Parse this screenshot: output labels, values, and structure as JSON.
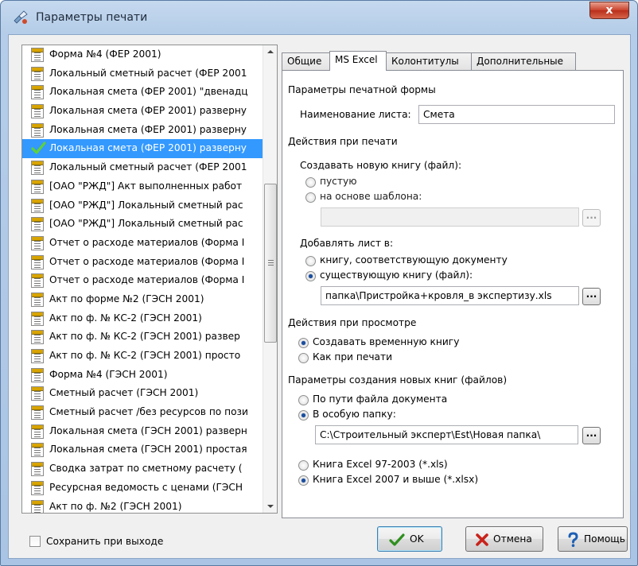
{
  "window": {
    "title": "Параметры печати",
    "close_label": "x"
  },
  "forms_list": {
    "selected_index": 5,
    "items": [
      "Форма №4 (ФЕР 2001)",
      "Локальный сметный расчет (ФЕР 2001",
      "Локальная смета (ФЕР 2001) \"двенадц",
      "Локальная смета (ФЕР 2001) разверну",
      "Локальная смета (ФЕР 2001) разверну",
      "Локальная смета (ФЕР 2001) разверну",
      "Локальный сметный расчет (ФЕР 2001",
      "[ОАО \"РЖД\"] Акт выполненных работ",
      "[ОАО \"РЖД\"] Локальный сметный рас",
      "[ОАО \"РЖД\"] Локальный сметный рас",
      "Отчет о расходе материалов (Форма I",
      "Отчет о расходе материалов (Форма I",
      "Отчет о расходе материалов (Форма I",
      "Акт по форме №2 (ГЭСН 2001)",
      "Акт по ф. № КС-2 (ГЭСН 2001)",
      "Акт по ф. № КС-2 (ГЭСН 2001) развер",
      "Акт по ф. № КС-2 (ГЭСН 2001) просто",
      "Форма №4 (ГЭСН 2001)",
      "Сметный расчет (ГЭСН 2001)",
      "Сметный расчет /без ресурсов по пози",
      "Локальная смета (ГЭСН 2001) разверн",
      "Локальная смета (ГЭСН 2001) простая",
      "Сводка затрат по сметному расчету (",
      "Ресурсная ведомость с ценами (ГЭСН",
      "Акт по ф. №2 (ГЭСН 2001)"
    ]
  },
  "tabs": [
    {
      "label": "Общие",
      "active": false
    },
    {
      "label": "MS Excel",
      "active": true
    },
    {
      "label": "Колонтитулы",
      "active": false
    },
    {
      "label": "Дополнительные",
      "active": false
    }
  ],
  "excel": {
    "print_form_group": "Параметры печатной формы",
    "sheet_name_label": "Наименование листа:",
    "sheet_name_value": "Смета",
    "print_actions_group": "Действия при печати",
    "create_book_label": "Создавать новую книгу (файл):",
    "opt_empty": "пустую",
    "opt_template": "на основе шаблона:",
    "template_path": "",
    "add_sheet_label": "Добавлять лист в:",
    "opt_doc_book": "книгу, соответствующую документу",
    "opt_existing_book": "существующую книгу (файл):",
    "existing_book_path": "папка\\Пристройка+кровля_в экспертизу.xls",
    "view_actions_group": "Действия при просмотре",
    "opt_temp_book": "Создавать временную книгу",
    "opt_as_print": "Как при печати",
    "new_books_group": "Параметры создания новых книг (файлов)",
    "opt_doc_path": "По пути файла документа",
    "opt_special_folder": "В особую папку:",
    "special_folder_path": "C:\\Строительный эксперт\\Est\\Новая папка\\",
    "opt_xls97": "Книга Excel 97-2003 (*.xls)",
    "opt_xlsx2007": "Книга Excel 2007 и выше (*.xlsx)",
    "browse_label": "..."
  },
  "footer": {
    "save_on_exit": "Сохранить при выходе",
    "ok": "OK",
    "cancel": "Отмена",
    "help": "Помощь"
  }
}
